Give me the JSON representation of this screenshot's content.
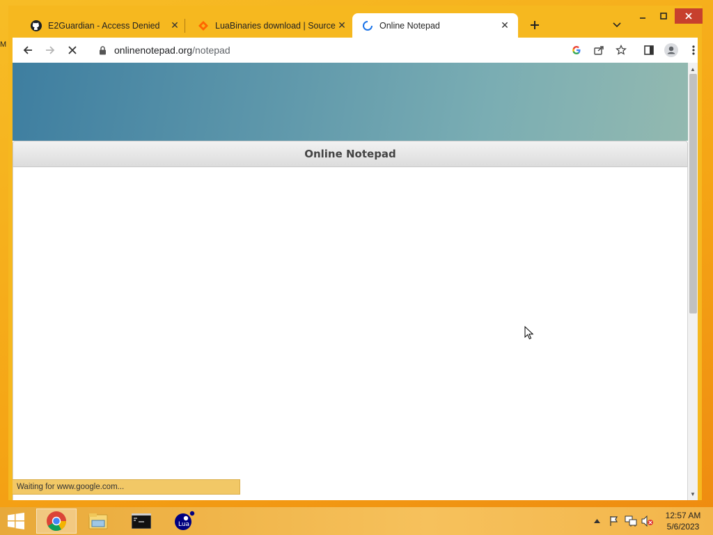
{
  "desktop": {
    "edge_label": "M"
  },
  "tabs": [
    {
      "title": "E2Guardian - Access Denied",
      "favicon": "github-icon",
      "active": false
    },
    {
      "title": "LuaBinaries download | SourceForge",
      "favicon": "sourceforge-icon",
      "active": false
    },
    {
      "title": "Online Notepad",
      "favicon": "loading-spinner-icon",
      "active": true
    }
  ],
  "toolbar": {
    "url_host": "onlinenotepad.org",
    "url_path": "/notepad"
  },
  "page": {
    "header_title": "Online Notepad",
    "editor_text": ""
  },
  "status": {
    "text": "Waiting for www.google.com..."
  },
  "taskbar": {
    "apps": [
      "chrome-icon",
      "file-explorer-icon",
      "command-prompt-icon",
      "lua-icon"
    ],
    "time": "12:57 AM",
    "date": "5/6/2023"
  },
  "colors": {
    "window_frame": "#f6b81f",
    "close_button": "#c7402d",
    "hero_start": "#3e7ea0",
    "hero_end": "#93b9b0",
    "spinner": "#1a73e8"
  }
}
